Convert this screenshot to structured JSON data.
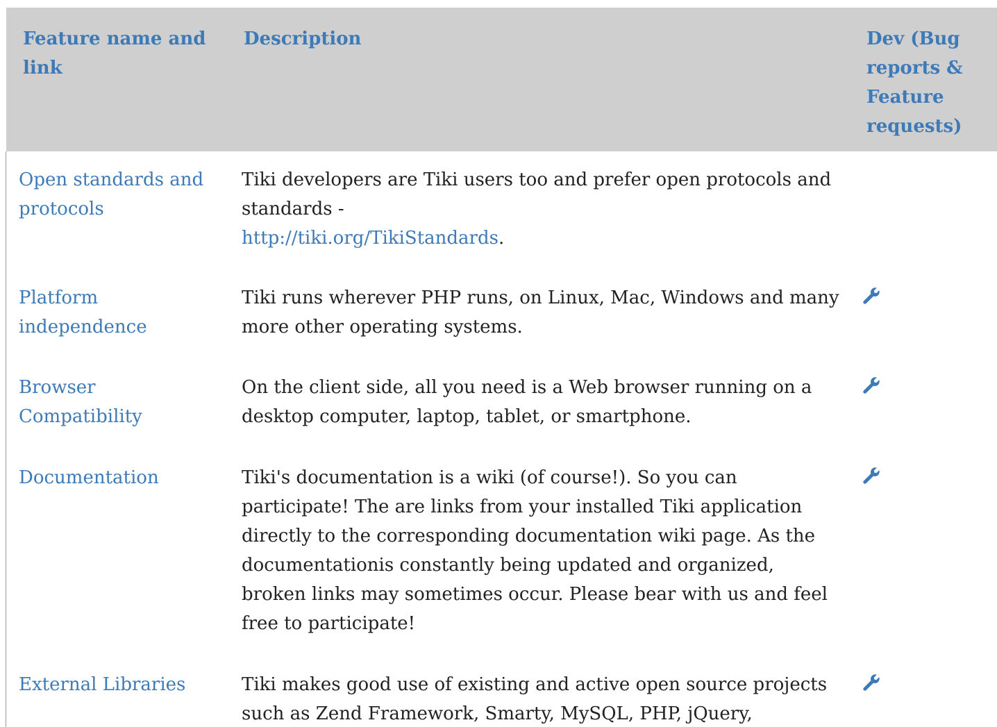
{
  "colors": {
    "header_bg": "#cfcfcf",
    "link": "#3d7ab8",
    "text": "#222222"
  },
  "table": {
    "headers": {
      "name": "Feature name and link",
      "description": "Description",
      "dev": "Dev (Bug reports & Feature requests)"
    },
    "rows": [
      {
        "name": "Open standards and protocols",
        "description": "Tiki developers are Tiki users too and prefer open protocols and standards -",
        "link_text": "http://tiki.org/TikiStandards",
        "link_suffix": ".",
        "dev_icon": ""
      },
      {
        "name": "Platform independence",
        "description": "Tiki runs wherever PHP runs, on Linux, Mac, Windows and many more other operating systems.",
        "dev_icon": "wrench-icon"
      },
      {
        "name": "Browser Compatibility",
        "description": "On the client side, all you need is a Web browser running on a desktop computer, laptop, tablet, or smartphone.",
        "dev_icon": "wrench-icon"
      },
      {
        "name": "Documentation",
        "description": "Tiki's documentation is a wiki (of course!). So you can participate! The are links from your installed Tiki application directly to the corresponding documentation wiki page. As the documentationis constantly being updated and organized, broken links may sometimes occur. Please bear with us and feel free to participate!",
        "dev_icon": "wrench-icon"
      },
      {
        "name": "External Libraries",
        "description": "Tiki makes good use of existing and active open source projects such as Zend Framework, Smarty, MySQL, PHP, jQuery, Bootstrap, CKeditor, etc.",
        "dev_icon": "wrench-icon"
      }
    ]
  }
}
